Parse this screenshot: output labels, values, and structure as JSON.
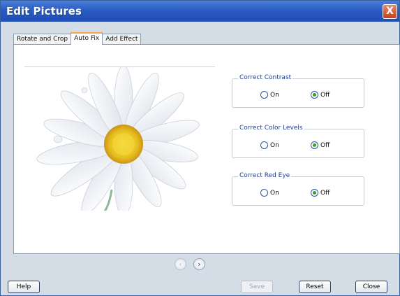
{
  "window": {
    "title": "Edit Pictures",
    "close_symbol": "X"
  },
  "tabs": [
    {
      "label": "Rotate and Crop"
    },
    {
      "label": "Auto Fix"
    },
    {
      "label": "Add Effect"
    }
  ],
  "groups": [
    {
      "title": "Correct Contrast",
      "on_label": "On",
      "off_label": "Off",
      "selected": "Off"
    },
    {
      "title": "Correct Color Levels",
      "on_label": "On",
      "off_label": "Off",
      "selected": "Off"
    },
    {
      "title": "Correct Red Eye",
      "on_label": "On",
      "off_label": "Off",
      "selected": "Off"
    }
  ],
  "nav": {
    "prev_symbol": "‹",
    "next_symbol": "›"
  },
  "buttons": {
    "help": "Help",
    "save": "Save",
    "reset": "Reset",
    "close": "Close"
  },
  "colors": {
    "titlebar": "#2a5cc4",
    "accent_tab": "#f1a54a",
    "group_title": "#1f3f8f",
    "radio_checked": "#3a9a3a"
  }
}
